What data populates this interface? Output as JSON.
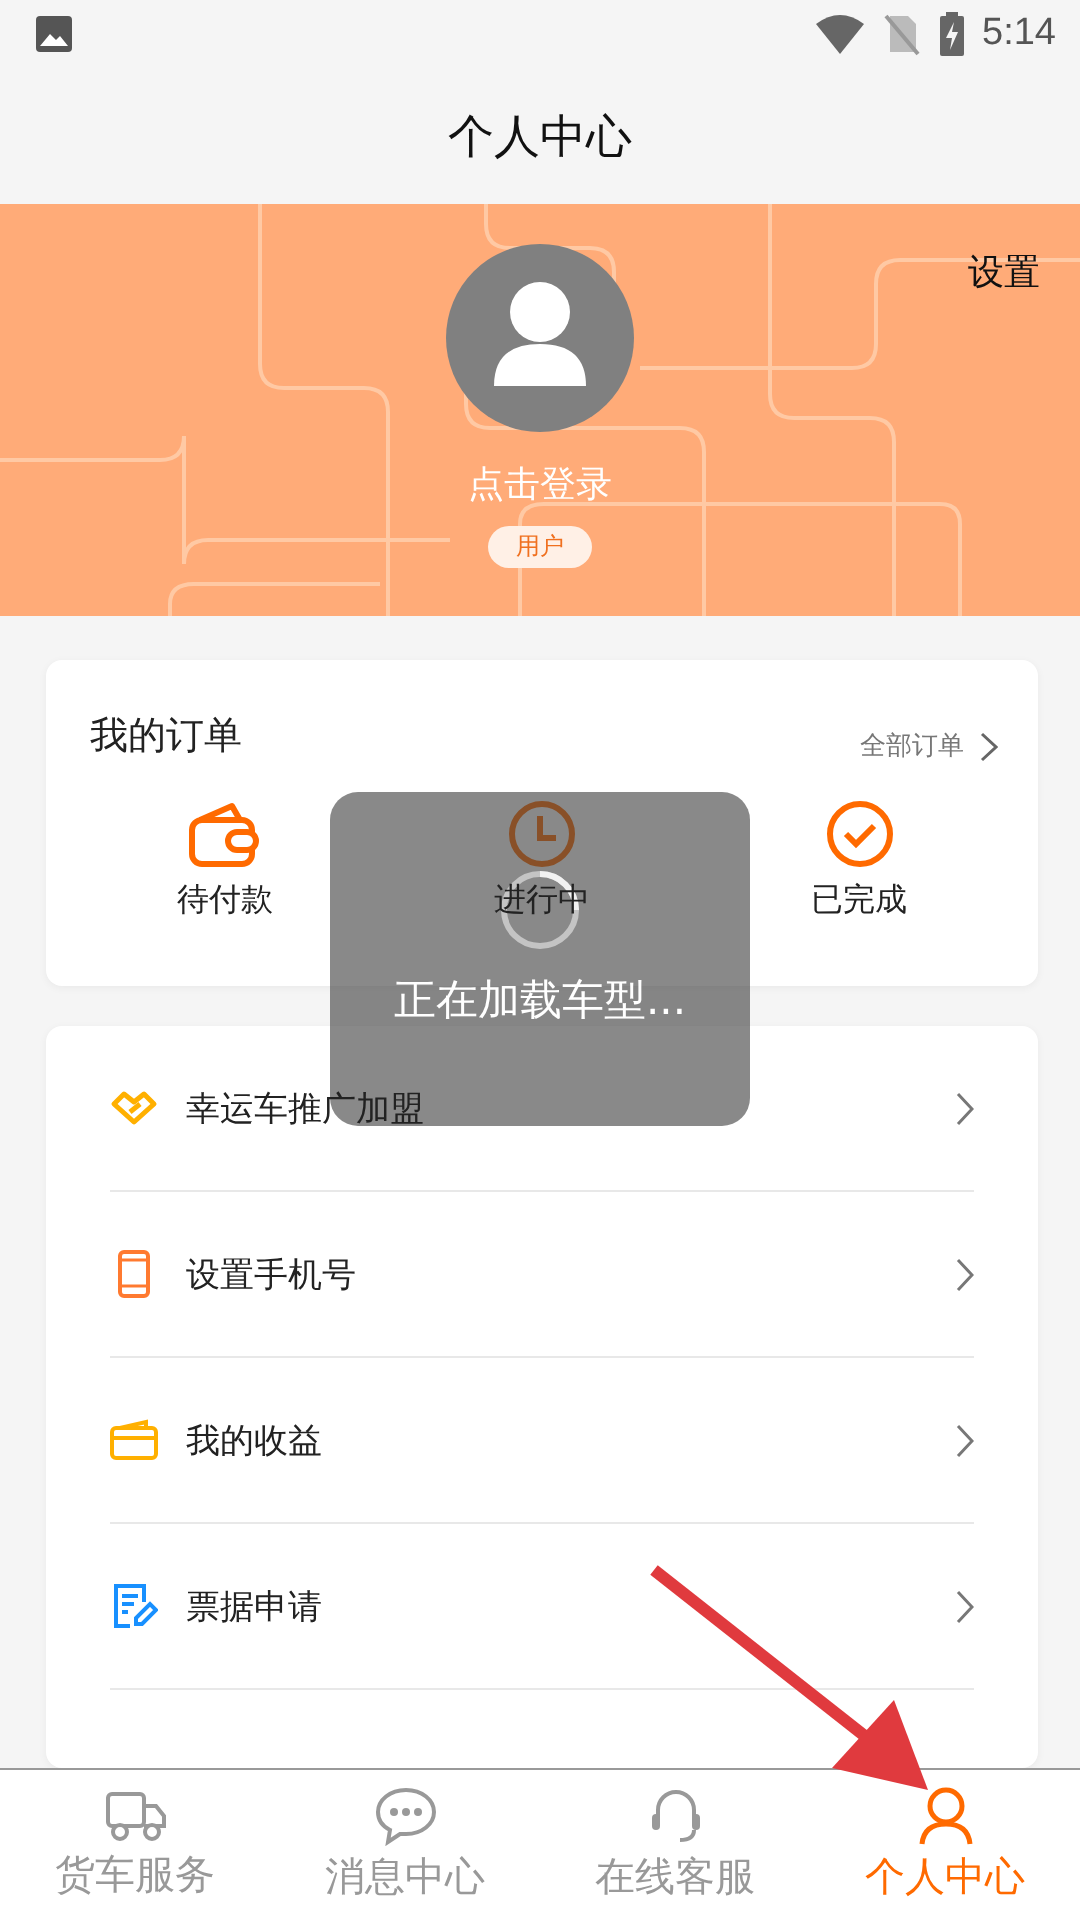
{
  "status_bar": {
    "time": "5:14"
  },
  "header": {
    "title": "个人中心"
  },
  "profile": {
    "settings": "设置",
    "login": "点击登录",
    "role_badge": "用户"
  },
  "orders": {
    "title": "我的订单",
    "all_link": "全部订单",
    "items": [
      {
        "kind": "wallet",
        "label": "待付款"
      },
      {
        "kind": "clock",
        "label": "进行中"
      },
      {
        "kind": "check",
        "label": "已完成"
      }
    ]
  },
  "menu": [
    {
      "kind": "handshake",
      "label": "幸运车推广加盟"
    },
    {
      "kind": "phone",
      "label": "设置手机号"
    },
    {
      "kind": "card",
      "label": "我的收益"
    },
    {
      "kind": "invoice",
      "label": "票据申请"
    }
  ],
  "toast": {
    "text": "正在加载车型..."
  },
  "tab_bar": [
    {
      "kind": "truck",
      "label": "货车服务",
      "selected": false
    },
    {
      "kind": "chat",
      "label": "消息中心",
      "selected": false
    },
    {
      "kind": "headset",
      "label": "在线客服",
      "selected": false
    },
    {
      "kind": "person",
      "label": "个人中心",
      "selected": true
    }
  ]
}
